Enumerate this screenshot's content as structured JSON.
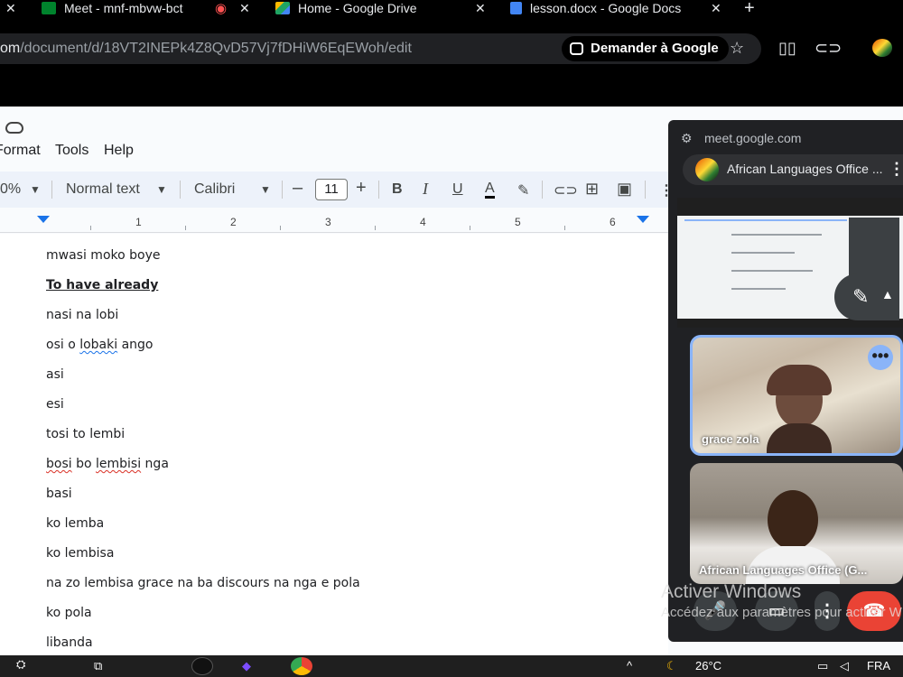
{
  "tabs": [
    {
      "label": "Meet - mnf-mbvw-bct",
      "color": "#00832d"
    },
    {
      "label": "Home - Google Drive",
      "color": "#1fa463"
    },
    {
      "label": "lesson.docx - Google Docs",
      "color": "#4285f4"
    }
  ],
  "address": {
    "url_prefix": "om",
    "url_rest": "/document/d/18VT2INEPk4Z8QvD57Vj7fDHiW6EqEWoh/edit",
    "ask_google": "Demander à Google"
  },
  "menu": [
    "Format",
    "Tools",
    "Help"
  ],
  "format_bar": {
    "zoom": "0%",
    "style": "Normal text",
    "font": "Calibri",
    "font_size": "11"
  },
  "ruler": [
    "1",
    "2",
    "3",
    "4",
    "5",
    "6"
  ],
  "document_lines": [
    "mwasi moko boye",
    "To have already",
    "nasi na lobi",
    "osi o lobaki ango",
    "asi",
    "esi",
    "tosi to lembi",
    "bosi bo lembisi nga",
    "basi",
    "ko lemba",
    "ko lembisa",
    "na zo lembisa grace na ba discours na nga e pola",
    "ko pola",
    "libanda"
  ],
  "meet": {
    "url": "meet.google.com",
    "title": "African Languages Office ...",
    "participants": [
      {
        "name": "grace zola"
      },
      {
        "name": "African Languages Office (G..."
      }
    ]
  },
  "watermark": {
    "line1": "Activer Windows",
    "line2": "Accédez aux paramètres pour activer W"
  },
  "taskbar": {
    "temperature": "26°C",
    "language": "FRA"
  }
}
